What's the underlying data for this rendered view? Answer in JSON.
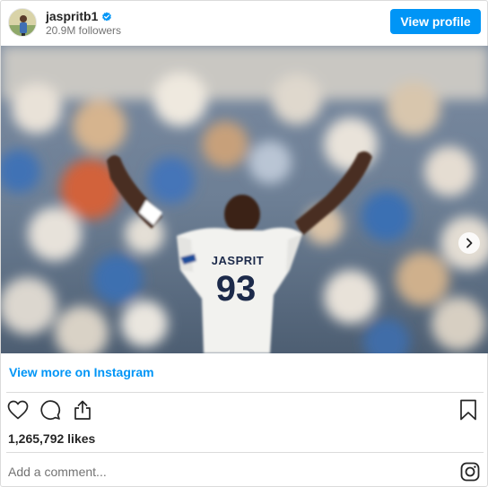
{
  "profile": {
    "username": "jaspritb1",
    "followers": "20.9M followers",
    "view_profile_label": "View profile"
  },
  "post": {
    "jersey_name": "JASPRIT",
    "jersey_number": "93",
    "view_more_label": "View more on Instagram",
    "likes": "1,265,792 likes"
  },
  "comment": {
    "placeholder": "Add a comment..."
  },
  "icons": {
    "verified": "verified-badge-icon",
    "next": "chevron-right-icon",
    "like": "heart-icon",
    "comment": "comment-icon",
    "share": "share-icon",
    "save": "bookmark-icon",
    "brand": "instagram-icon"
  },
  "colors": {
    "accent": "#0095f6",
    "verified": "#0095f6",
    "text": "#262626",
    "secondary": "#737373",
    "divider": "#dbdbdb"
  }
}
